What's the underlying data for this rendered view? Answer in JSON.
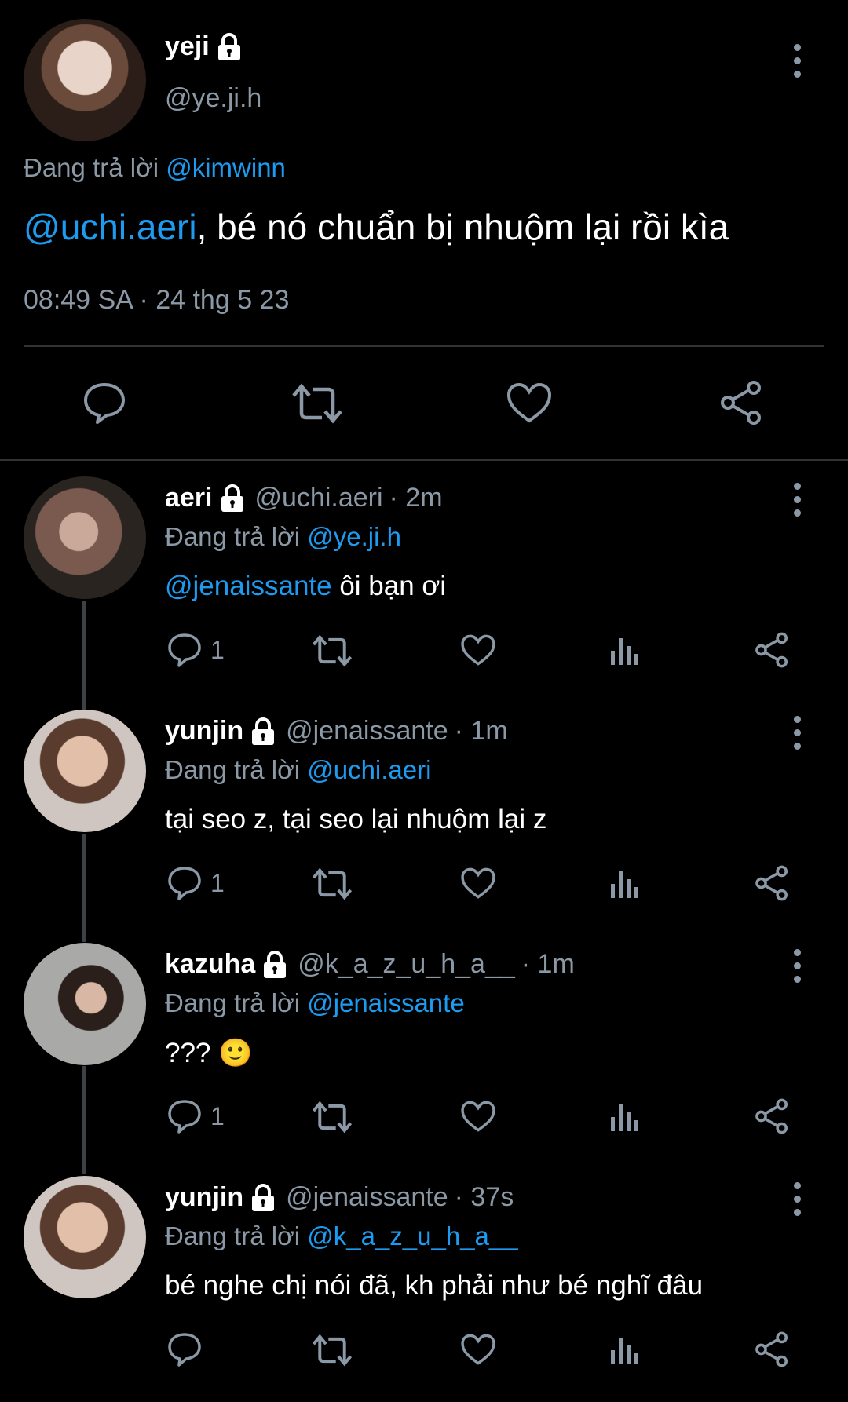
{
  "main_tweet": {
    "display_name": "yeji",
    "handle": "@ye.ji.h",
    "reply_prefix": "Đang trả lời",
    "reply_to": "@kimwinn",
    "mention": "@uchi.aeri",
    "text": ", bé nó chuẩn bị nhuộm lại rồi kìa",
    "timestamp": "08:49 SA · 24 thg 5 23"
  },
  "replies": [
    {
      "display_name": "aeri",
      "handle": "@uchi.aeri",
      "time": "· 2m",
      "reply_prefix": "Đang trả lời",
      "reply_to": "@ye.ji.h",
      "mention": "@jenaissante",
      "text": " ôi bạn ơi",
      "reply_count": "1"
    },
    {
      "display_name": "yunjin",
      "handle": "@jenaissante",
      "time": "· 1m",
      "reply_prefix": "Đang trả lời",
      "reply_to": "@uchi.aeri",
      "mention": "",
      "text": "tại seo z, tại seo lại nhuộm lại z",
      "reply_count": "1"
    },
    {
      "display_name": "kazuha",
      "handle": "@k_a_z_u_h_a__",
      "time": "· 1m",
      "reply_prefix": "Đang trả lời",
      "reply_to": "@jenaissante",
      "mention": "",
      "text": "??? 🙂",
      "reply_count": "1"
    },
    {
      "display_name": "yunjin",
      "handle": "@jenaissante",
      "time": "· 37s",
      "reply_prefix": "Đang trả lời",
      "reply_to": "@k_a_z_u_h_a__",
      "mention": "",
      "text": "bé nghe chị nói đã, kh phải như bé nghĩ đâu",
      "reply_count": ""
    }
  ],
  "icons": {
    "lock": "lock-icon",
    "menu": "more-vertical-icon",
    "reply": "reply-icon",
    "retweet": "retweet-icon",
    "like": "heart-icon",
    "views": "views-icon",
    "share": "share-icon"
  },
  "colors": {
    "background": "#000000",
    "link": "#1d9bf0",
    "muted": "#8b98a5"
  }
}
